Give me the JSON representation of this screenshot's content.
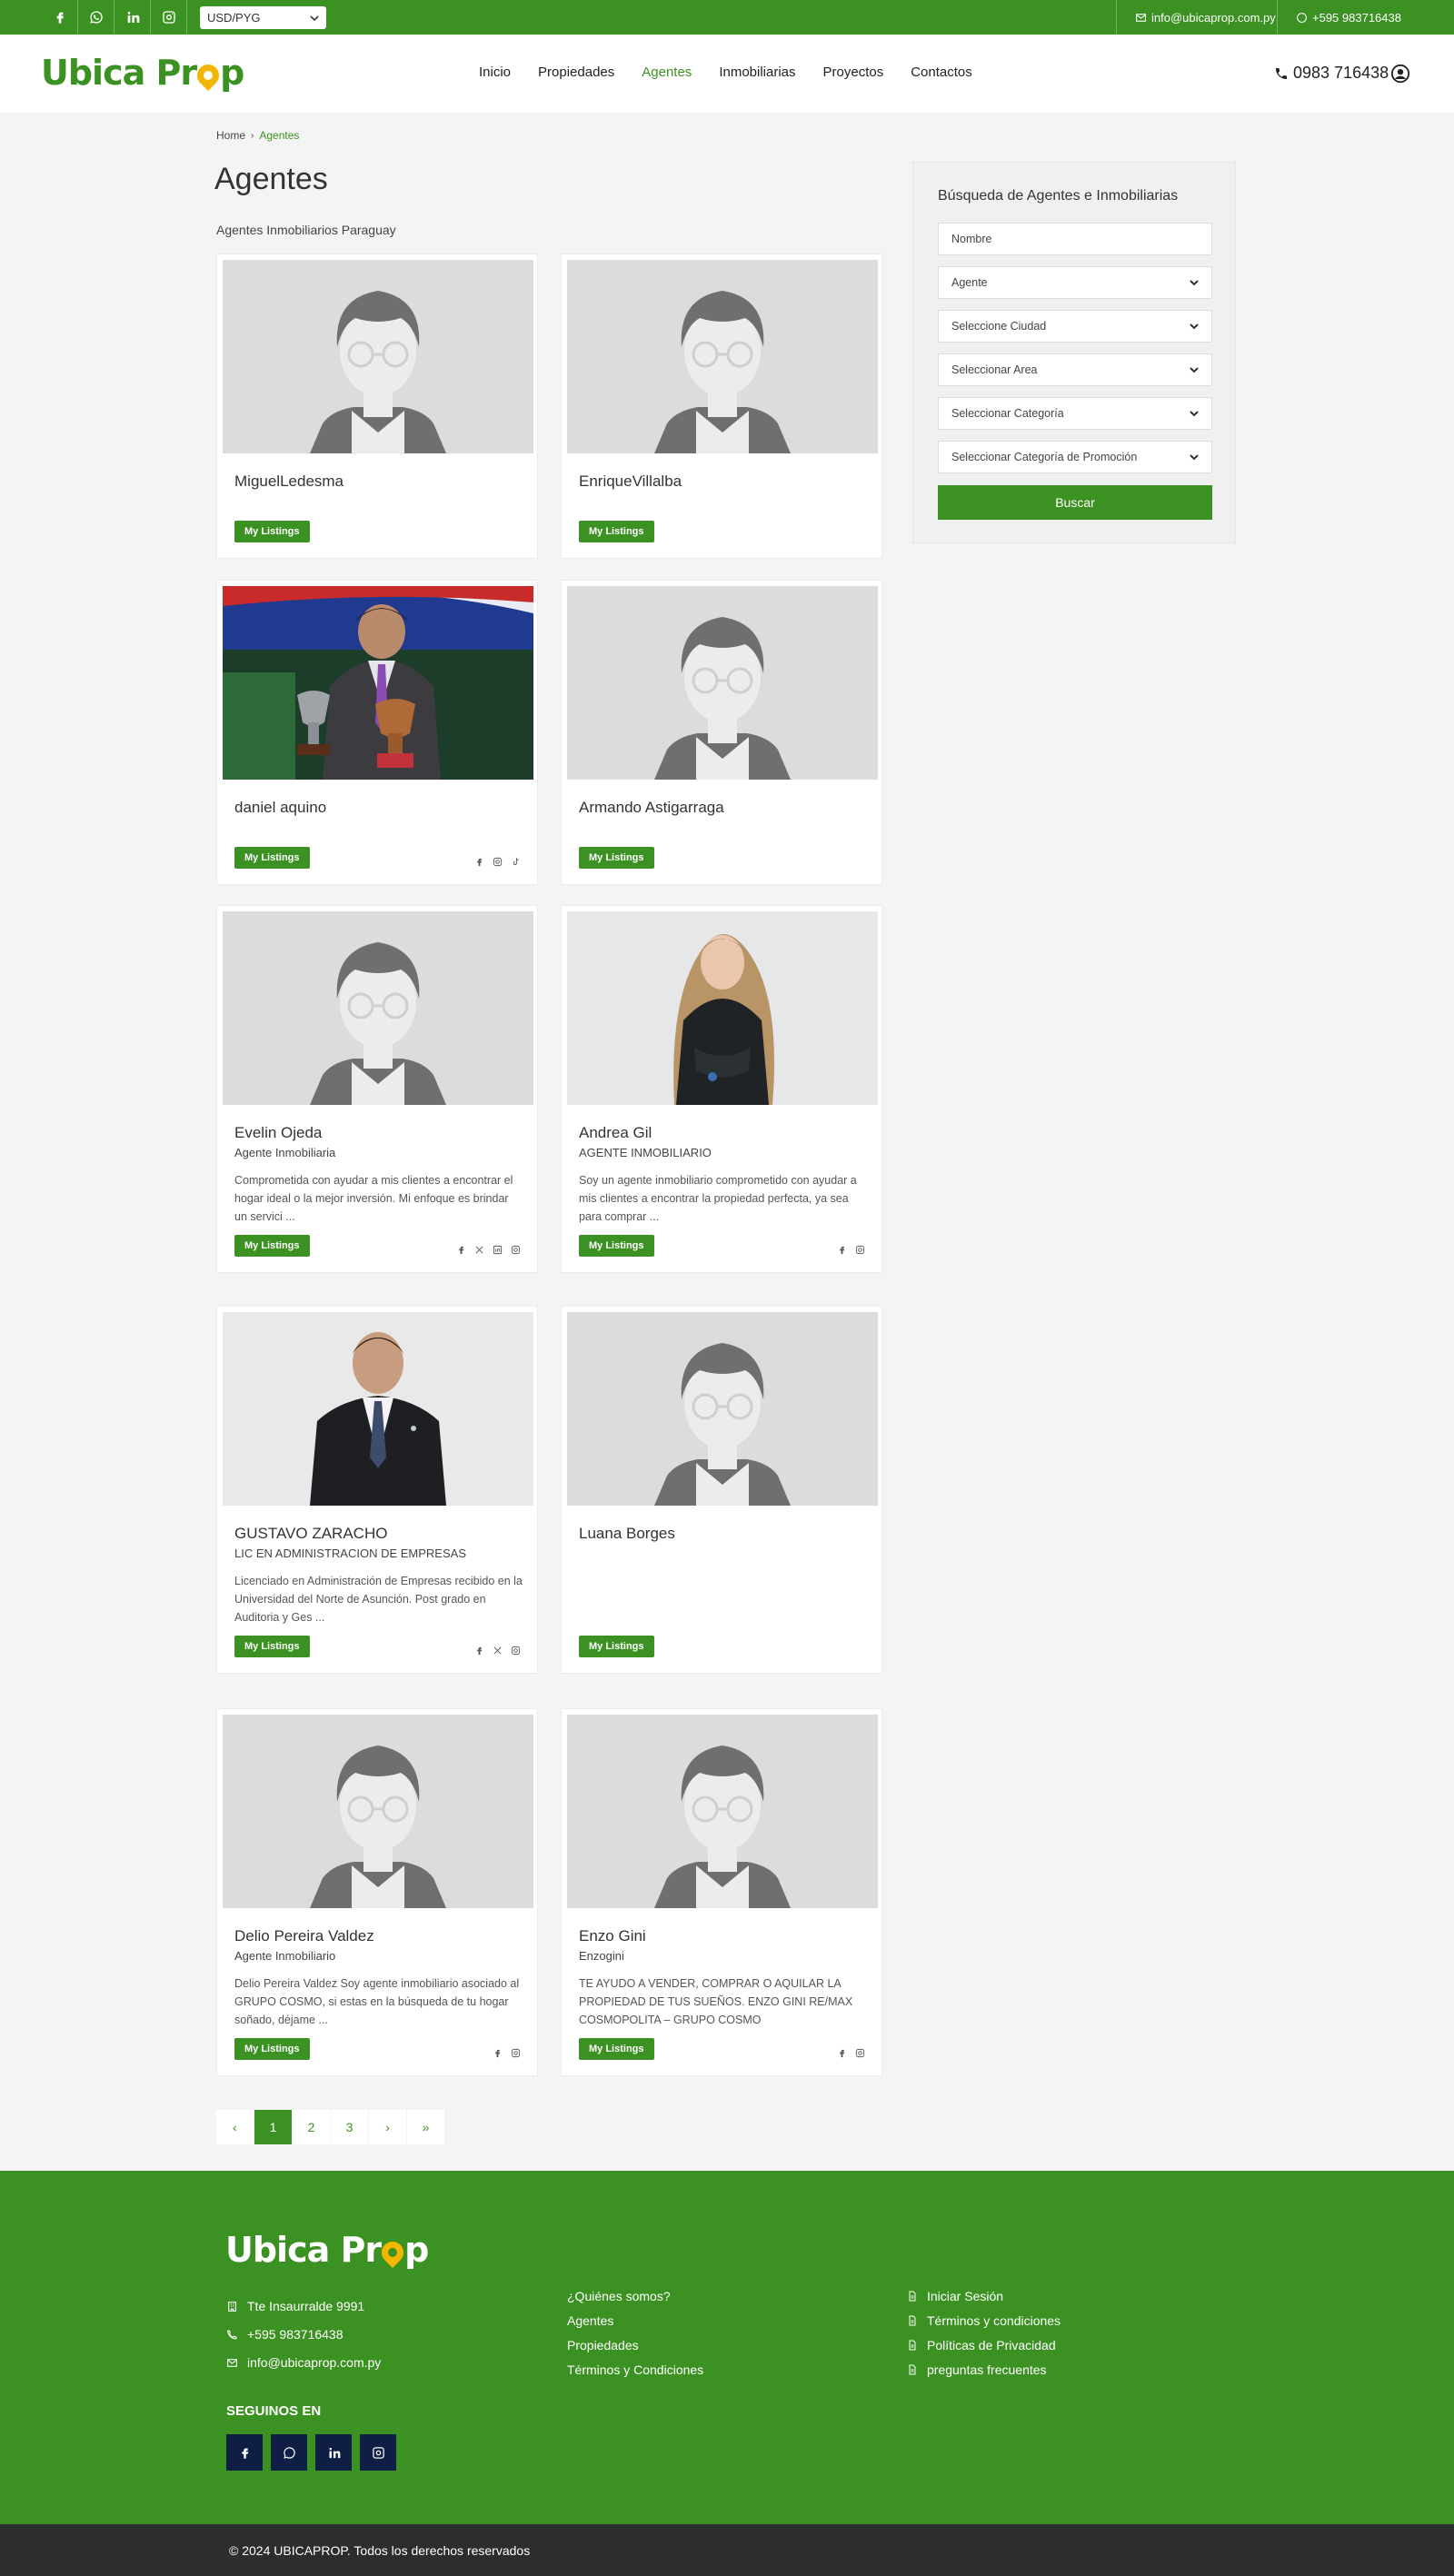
{
  "topbar": {
    "currency": "USD/PYG",
    "email": "info@ubicaprop.com.py",
    "phone": "+595 983716438"
  },
  "header": {
    "logo_left": "Ubica Pr",
    "logo_right": "p",
    "nav": [
      "Inicio",
      "Propiedades",
      "Agentes",
      "Inmobiliarias",
      "Proyectos",
      "Contactos"
    ],
    "active_nav": "Agentes",
    "phone": "0983 716438"
  },
  "breadcrumb": {
    "home": "Home",
    "current": "Agentes"
  },
  "page": {
    "title": "Agentes",
    "subtitle": "Agentes Inmobiliarios Paraguay"
  },
  "agents": [
    {
      "name": "MiguelLedesma",
      "role": "",
      "bio": "",
      "photo": "placeholder",
      "socials": [],
      "button": "My Listings"
    },
    {
      "name": "EnriqueVillalba",
      "role": "",
      "bio": "",
      "photo": "placeholder",
      "socials": [],
      "button": "My Listings"
    },
    {
      "name": "daniel aquino",
      "role": "",
      "bio": "",
      "photo": "trophy-photo",
      "socials": [
        "facebook-icon",
        "instagram-icon",
        "tiktok-icon"
      ],
      "button": "My Listings"
    },
    {
      "name": "Armando Astigarraga",
      "role": "",
      "bio": "",
      "photo": "placeholder",
      "socials": [],
      "button": "My Listings"
    },
    {
      "name": "Evelin Ojeda",
      "role": "Agente Inmobiliaria",
      "bio": "Comprometida con ayudar a mis clientes a encontrar el hogar ideal o la mejor inversión. Mi enfoque es brindar un servici ...",
      "photo": "placeholder",
      "socials": [
        "facebook-icon",
        "x-icon",
        "linkedin-icon",
        "instagram-icon"
      ],
      "button": "My Listings"
    },
    {
      "name": "Andrea Gil",
      "role": "AGENTE INMOBILIARIO",
      "bio": "Soy un agente inmobiliario comprometido con ayudar a mis clientes a encontrar la propiedad perfecta, ya sea para comprar ...",
      "photo": "woman-photo",
      "socials": [
        "facebook-icon",
        "instagram-icon"
      ],
      "button": "My Listings"
    },
    {
      "name": "GUSTAVO ZARACHO",
      "role": "LIC EN ADMINISTRACION DE EMPRESAS",
      "bio": "Licenciado en Administración de Empresas recibido en la Universidad del Norte de Asunción. Post grado en Auditoria y Ges ...",
      "photo": "suit-photo",
      "socials": [
        "facebook-icon",
        "x-icon",
        "instagram-icon"
      ],
      "button": "My Listings"
    },
    {
      "name": "Luana Borges",
      "role": "",
      "bio": "",
      "photo": "placeholder",
      "socials": [],
      "button": "My Listings"
    },
    {
      "name": "Delio Pereira Valdez",
      "role": "Agente Inmobiliario",
      "bio": "Delio Pereira Valdez Soy agente inmobiliario asociado al GRUPO COSMO, si estas en la búsqueda de tu hogar soñado, déjame ...",
      "photo": "placeholder",
      "socials": [
        "facebook-icon",
        "instagram-icon"
      ],
      "button": "My Listings"
    },
    {
      "name": "Enzo Gini",
      "role": "Enzogini",
      "bio": "TE AYUDO A VENDER, COMPRAR O AQUILAR LA PROPIEDAD DE TUS SUEÑOS. ENZO GINI RE/MAX COSMOPOLITA – GRUPO COSMO",
      "photo": "placeholder",
      "socials": [
        "facebook-icon",
        "instagram-icon"
      ],
      "button": "My Listings"
    }
  ],
  "pagination": {
    "prev": "‹",
    "pages": [
      "1",
      "2",
      "3"
    ],
    "current": "1",
    "next": "›",
    "last": "»"
  },
  "sidebar": {
    "title": "Búsqueda de Agentes e Inmobiliarias",
    "name_placeholder": "Nombre",
    "selects": [
      "Agente",
      "Seleccione Ciudad",
      "Seleccionar Area",
      "Seleccionar Categoría",
      "Seleccionar Categoría de Promoción"
    ],
    "button": "Buscar"
  },
  "footer": {
    "logo_left": "Ubica Pr",
    "logo_right": "p",
    "address": "Tte Insaurralde 9991",
    "phone": "+595 983716438",
    "email": "info@ubicaprop.com.py",
    "follow": "SEGUINOS EN",
    "links_col1": [
      "¿Quiénes somos?",
      "Agentes",
      "Propiedades",
      "Términos y Condiciones"
    ],
    "links_col2": [
      "Iniciar Sesión",
      "Términos y condiciones",
      "Políticas de Privacidad",
      "preguntas frecuentes"
    ],
    "copyright": "© 2024 UBICAPROP. Todos los derechos reservados"
  },
  "colors": {
    "brand_green": "#3c9123",
    "logo_pin": "#f2b600",
    "social_button": "#0e1e45",
    "bottom_bar": "#2b2d2e"
  }
}
